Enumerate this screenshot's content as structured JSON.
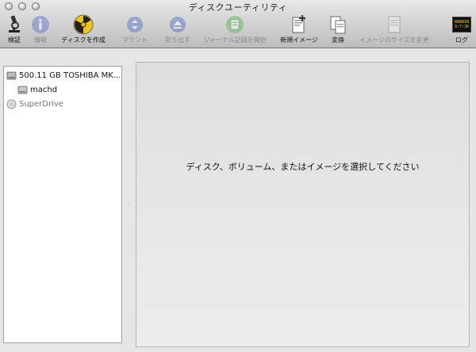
{
  "window": {
    "title": "ディスクユーティリティ"
  },
  "toolbar": {
    "items": [
      {
        "label": "検証",
        "icon": "microscope-icon",
        "enabled": true
      },
      {
        "label": "情報",
        "icon": "info-icon",
        "enabled": false
      },
      {
        "label": "ディスクを作成",
        "icon": "burn-icon",
        "enabled": true
      },
      {
        "label": "マウント",
        "icon": "mount-icon",
        "enabled": false
      },
      {
        "label": "取り出す",
        "icon": "eject-icon",
        "enabled": false
      },
      {
        "label": "ジャーナル記録を開始",
        "icon": "journal-icon",
        "enabled": false
      },
      {
        "label": "新規イメージ",
        "icon": "new-image-icon",
        "enabled": true
      },
      {
        "label": "変換",
        "icon": "convert-icon",
        "enabled": true
      },
      {
        "label": "イメージのサイズを変更",
        "icon": "resize-image-icon",
        "enabled": false
      },
      {
        "label": "ログ",
        "icon": "log-icon",
        "enabled": true,
        "log_text_line1": "WARNIN",
        "log_text_line2": "9:7:36"
      }
    ]
  },
  "sidebar": {
    "disk_label": "500.11 GB TOSHIBA MK...",
    "volume_label": "machd",
    "drive_label": "SuperDrive"
  },
  "main": {
    "message": "ディスク、ボリューム、またはイメージを選択してください"
  },
  "colors": {
    "toolbar_top": "#e8e8e8",
    "toolbar_bottom": "#bdbdbd",
    "main_bg": "#e6e6e6",
    "info_blue": "#7d8fd6",
    "burn_yellow": "#f0c419"
  }
}
